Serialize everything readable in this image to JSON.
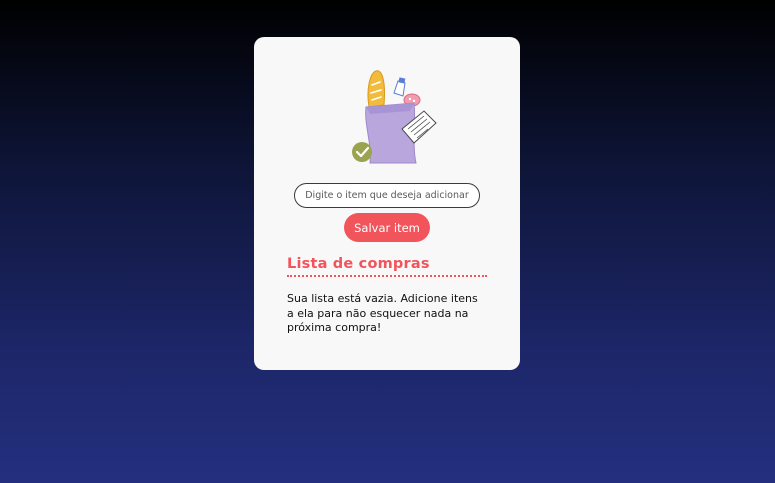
{
  "form": {
    "input_value": "",
    "input_placeholder": "Digite o item que deseja adicionar",
    "save_label": "Salvar item"
  },
  "list": {
    "title": "Lista de compras",
    "empty_message": "Sua lista está vazia. Adicione itens a ela para não esquecer nada na próxima compra!"
  },
  "illustration": {
    "icon": "grocery-bag-icon",
    "check_icon": "check-circle-icon"
  },
  "colors": {
    "accent": "#f1545b",
    "card": "#f8f8f9",
    "bag": "#b9a6dd",
    "bread": "#f2bb3c",
    "check": "#9aa34d"
  }
}
